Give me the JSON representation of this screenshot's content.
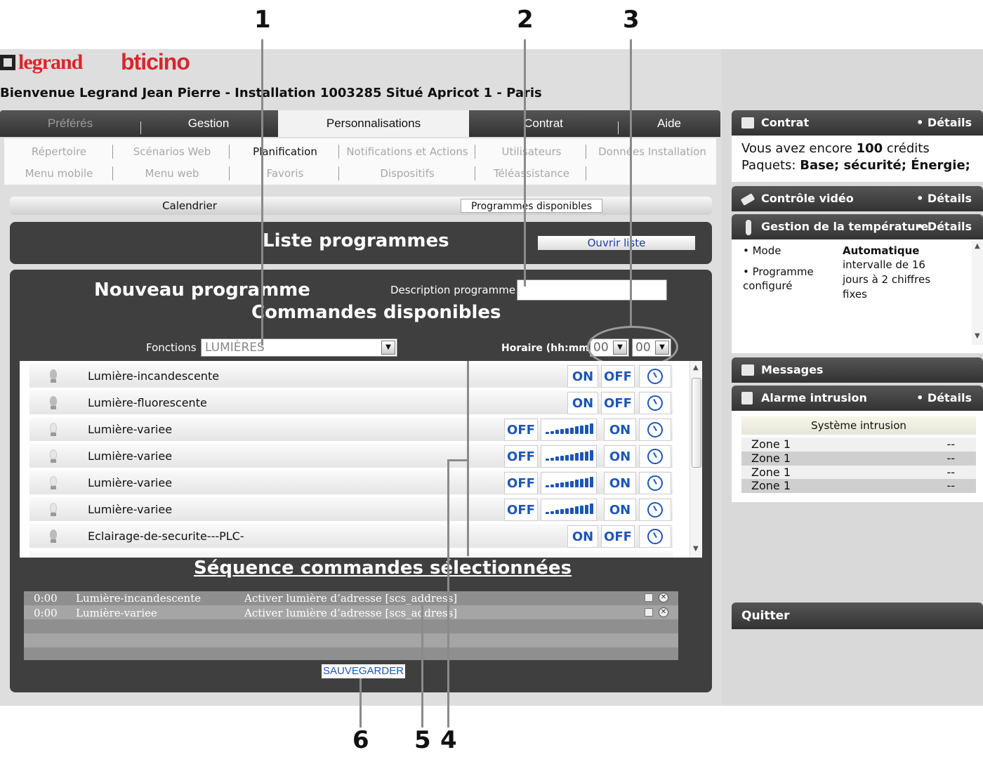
{
  "callouts": [
    "1",
    "2",
    "3",
    "4",
    "5",
    "6"
  ],
  "branding": {
    "logo_legrand": "legrand",
    "logo_bticino": "bticino"
  },
  "welcome": "Bienvenue Legrand Jean Pierre - Installation 1003285 Situé Apricot 1 - Paris",
  "main_tabs": [
    {
      "label": "Préférés",
      "state": "disabled"
    },
    {
      "label": "Gestion",
      "state": "normal"
    },
    {
      "label": "Personnalisations",
      "state": "active"
    },
    {
      "label": "Contrat",
      "state": "normal"
    },
    {
      "label": "Aide",
      "state": "normal"
    }
  ],
  "sub_menu": [
    [
      "Répertoire",
      "Scénarios Web",
      "Planification",
      "Notifications et Actions",
      "Utilisateurs",
      "Données Installation"
    ],
    [
      "Menu mobile",
      "Menu web",
      "Favoris",
      "Dispositifs",
      "Téléassistance"
    ]
  ],
  "sub_menu_active": "Planification",
  "calendar_bar": {
    "calendar": "Calendrier",
    "programmes": "Programmes disponibles"
  },
  "liste_panel": {
    "title": "Liste programmes",
    "open_button": "Ouvrir liste"
  },
  "new_program": {
    "title": "Nouveau programme",
    "description_label": "Description programme",
    "description_value": "",
    "commands_title": "Commandes disponibles",
    "functions_label": "Fonctions",
    "functions_value": "LUMIÈRES",
    "hour_label": "Horaire (hh:mm)",
    "hour_value": "00",
    "minute_value": "00"
  },
  "commands": [
    {
      "name": "Lumière-incandescente",
      "type": "onoff",
      "b1": "ON",
      "b2": "OFF"
    },
    {
      "name": "Lumière-fluorescente",
      "type": "onoff",
      "b1": "ON",
      "b2": "OFF"
    },
    {
      "name": "Lumière-variee",
      "type": "dimmer",
      "b1": "OFF",
      "b2": "ON"
    },
    {
      "name": "Lumière-variee",
      "type": "dimmer",
      "b1": "OFF",
      "b2": "ON"
    },
    {
      "name": "Lumière-variee",
      "type": "dimmer",
      "b1": "OFF",
      "b2": "ON"
    },
    {
      "name": "Lumière-variee",
      "type": "dimmer",
      "b1": "OFF",
      "b2": "ON"
    },
    {
      "name": "Eclairage-de-securite---PLC-",
      "type": "onoff",
      "b1": "ON",
      "b2": "OFF"
    }
  ],
  "sequence": {
    "title": "Séquence commandes sélectionnées",
    "rows": [
      {
        "time": "0:00",
        "name": "Lumière-incandescente",
        "action": "Activer lumière d’adresse [scs_address]"
      },
      {
        "time": "0:00",
        "name": "Lumière-variee",
        "action": "Activer lumière d’adresse [scs_address]"
      }
    ],
    "save_button": "SAUVEGARDER"
  },
  "sidebar": {
    "contract": {
      "title": "Contrat",
      "details": "• Détails",
      "line1_prefix": "Vous avez encore ",
      "credits": "100",
      "line1_suffix": " crédits",
      "line2_prefix": "Paquets: ",
      "packages": "Base; sécurité; Énergie;"
    },
    "video": {
      "title": "Contrôle vidéo",
      "details": "• Détails"
    },
    "temperature": {
      "title": "Gestion de la température",
      "details": "• Détails",
      "mode_label": "• Mode",
      "mode_value": "Automatique",
      "program_label": "• Programme",
      "program_label2": "configuré",
      "program_value": "intervalle de 16 jours à 2 chiffres fixes"
    },
    "messages": {
      "title": "Messages"
    },
    "alarm": {
      "title": "Alarme intrusion",
      "details": "• Détails",
      "system_title": "Système intrusion",
      "zones": [
        {
          "zone": "Zone 1",
          "value": "--"
        },
        {
          "zone": "Zone 1",
          "value": "--"
        },
        {
          "zone": "Zone 1",
          "value": "--"
        },
        {
          "zone": "Zone 1",
          "value": "--"
        }
      ]
    },
    "quit": "Quitter"
  },
  "colors": {
    "accent": "#1d56b5",
    "panel": "#3f3f3f",
    "brand_red": "#d8262c"
  }
}
